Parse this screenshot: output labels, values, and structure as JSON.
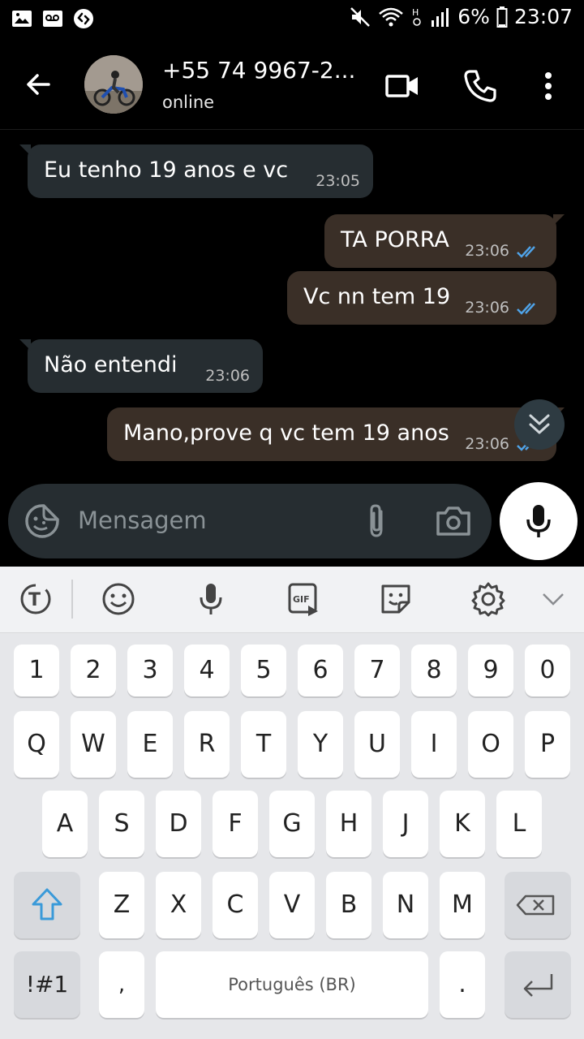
{
  "status_bar": {
    "battery": "6%",
    "time": "23:07",
    "icons": [
      "gallery-icon",
      "voicemail-icon",
      "shazam-icon",
      "mute-icon",
      "wifi-icon",
      "hd-icon",
      "signal-icon",
      "battery-icon"
    ]
  },
  "header": {
    "contact_name": "+55 74 9967-2...",
    "status": "online"
  },
  "messages": [
    {
      "direction": "in",
      "text": "Eu tenho 19 anos e vc",
      "time": "23:05"
    },
    {
      "direction": "out",
      "text": "TA PORRA",
      "time": "23:06",
      "read": true
    },
    {
      "direction": "out",
      "text": "Vc nn tem 19",
      "time": "23:06",
      "read": true
    },
    {
      "direction": "in",
      "text": "Não entendi",
      "time": "23:06"
    },
    {
      "direction": "out",
      "text": "Mano,prove q vc tem 19 anos",
      "time": "23:06",
      "read": true
    }
  ],
  "composer": {
    "placeholder": "Mensagem"
  },
  "keyboard": {
    "number_row": [
      "1",
      "2",
      "3",
      "4",
      "5",
      "6",
      "7",
      "8",
      "9",
      "0"
    ],
    "row1": [
      "Q",
      "W",
      "E",
      "R",
      "T",
      "Y",
      "U",
      "I",
      "O",
      "P"
    ],
    "row2": [
      "A",
      "S",
      "D",
      "F",
      "G",
      "H",
      "J",
      "K",
      "L"
    ],
    "row3": [
      "Z",
      "X",
      "C",
      "V",
      "B",
      "N",
      "M"
    ],
    "symbols_key": "!#1",
    "comma_key": ",",
    "space_label": "Português (BR)",
    "period_key": ".",
    "toolbar": [
      "translate-icon",
      "emoji-icon",
      "voice-icon",
      "gif-icon",
      "sticker-icon",
      "settings-icon",
      "collapse-icon"
    ]
  },
  "colors": {
    "incoming_bubble": "#262d31",
    "outgoing_bubble": "#3a2f27",
    "read_ticks": "#4fa3e8"
  }
}
